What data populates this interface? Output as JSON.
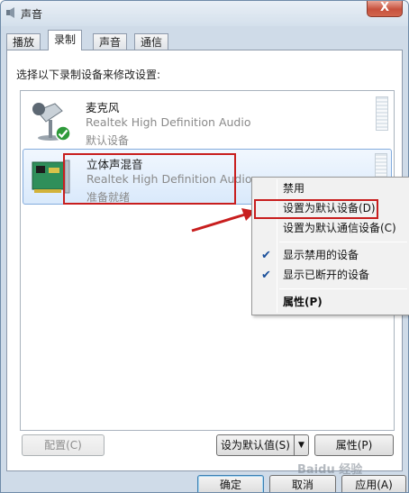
{
  "window": {
    "title": "声音",
    "close_glyph": "X"
  },
  "tabs": [
    {
      "label": "播放",
      "active": false
    },
    {
      "label": "录制",
      "active": true
    },
    {
      "label": "声音",
      "active": false
    },
    {
      "label": "通信",
      "active": false
    }
  ],
  "instruction": "选择以下录制设备来修改设置:",
  "devices": [
    {
      "name": "麦克风",
      "driver": "Realtek High Definition Audio",
      "status": "默认设备",
      "icon": "microphone-icon",
      "default_badge": "check-badge-icon"
    },
    {
      "name": "立体声混音",
      "driver": "Realtek High Definition Audio",
      "status": "准备就绪",
      "icon": "sound-card-icon",
      "selected": true
    }
  ],
  "context_menu": {
    "items": [
      {
        "label": "禁用",
        "checked": false
      },
      {
        "label": "设置为默认设备(D)",
        "checked": false,
        "highlighted": true
      },
      {
        "label": "设置为默认通信设备(C)",
        "checked": false
      },
      {
        "label": "显示禁用的设备",
        "checked": true
      },
      {
        "label": "显示已断开的设备",
        "checked": true
      },
      {
        "label": "属性(P)",
        "checked": false,
        "bold": true
      }
    ],
    "check_glyph": "✔"
  },
  "buttons": {
    "configure": "配置(C)",
    "set_default": "设为默认值(S)",
    "split_arrow": "▼",
    "properties": "属性(P)",
    "ok": "确定",
    "cancel": "取消",
    "apply": "应用(A)"
  },
  "watermark": "Baidu 经验",
  "colors": {
    "highlight_red": "#c81e1e",
    "selection_blue": "#84acdd",
    "check_blue": "#1a4f9a"
  }
}
